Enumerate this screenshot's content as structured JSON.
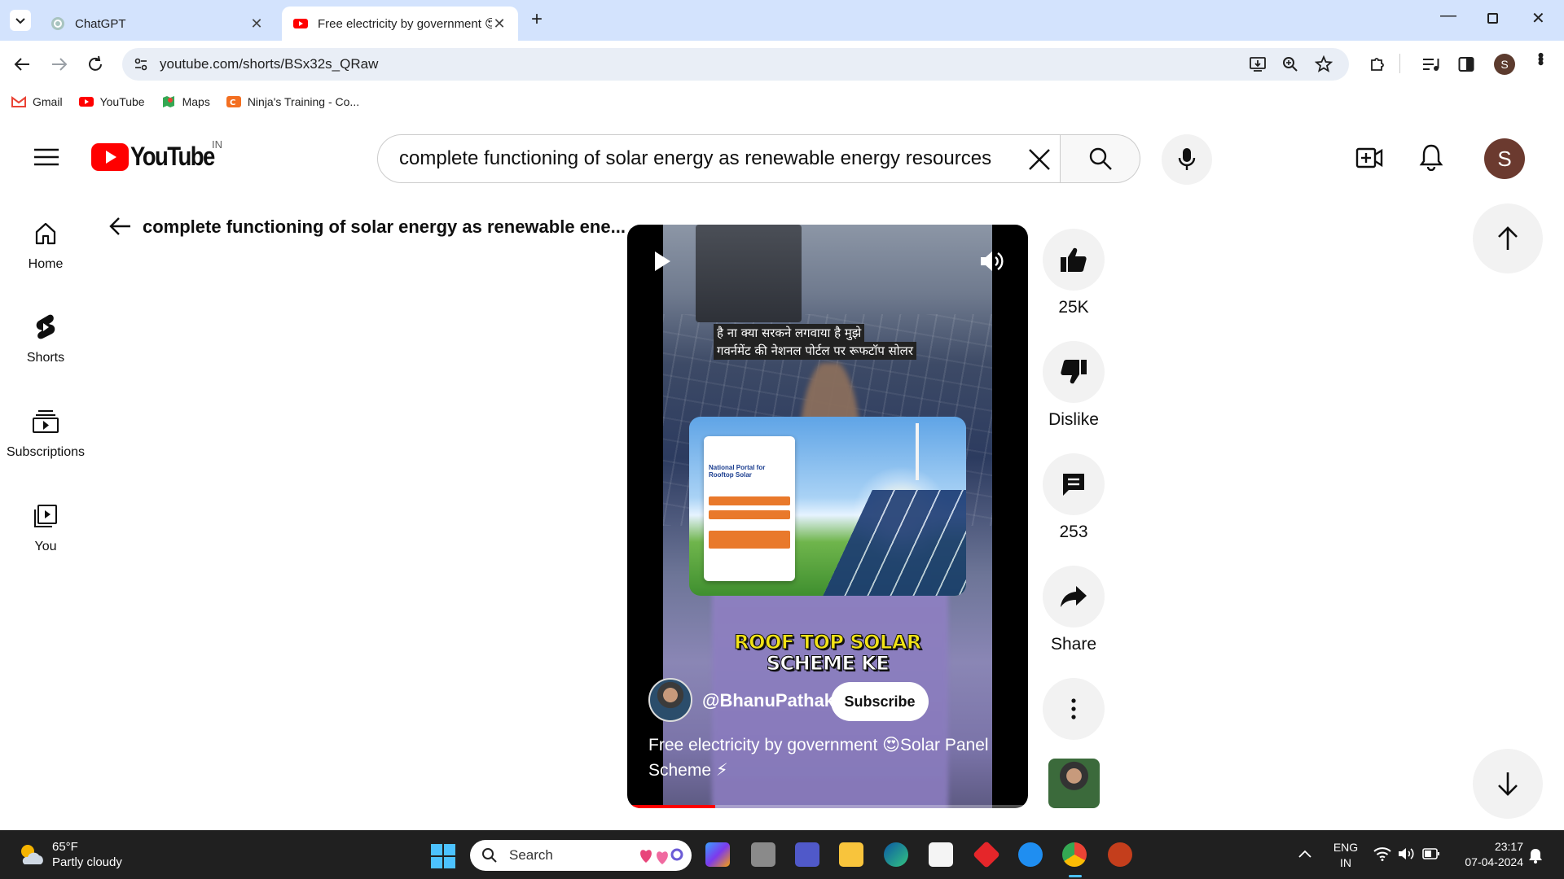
{
  "browser": {
    "tabs": [
      {
        "title": "ChatGPT",
        "active": false
      },
      {
        "title": "Free electricity by government 😍",
        "active": true
      }
    ],
    "url": "youtube.com/shorts/BSx32s_QRaw",
    "profile_initial": "S",
    "bookmarks": [
      "Gmail",
      "YouTube",
      "Maps",
      "Ninja's Training - Co..."
    ]
  },
  "youtube": {
    "logo_text": "YouTube",
    "region": "IN",
    "search_query": "complete functioning of solar energy as renewable energy resources",
    "avatar_initial": "S",
    "back_title": "complete functioning of solar energy as renewable ene...",
    "nav": [
      {
        "label": "Home",
        "icon": "home-icon"
      },
      {
        "label": "Shorts",
        "icon": "shorts-icon"
      },
      {
        "label": "Subscriptions",
        "icon": "subscriptions-icon"
      },
      {
        "label": "You",
        "icon": "you-icon"
      }
    ]
  },
  "video": {
    "caption_line1": "है ना क्या सरकने लगवाया है मुझे",
    "caption_line2": "गवर्नमेंट की नेशनल पोर्टल पर रूफटॉप सोलर",
    "overlay_line1": "ROOF TOP SOLAR",
    "overlay_line2": "SCHEME KE",
    "inset_portal_title": "National Portal for Rooftop Solar",
    "channel": "@BhanuPathak",
    "subscribe_label": "Subscribe",
    "title_line1": "Free electricity by government 😍Solar Panel",
    "title_line2": "Scheme ⚡",
    "progress_fraction": 0.22
  },
  "actions": {
    "likes": "25K",
    "dislike": "Dislike",
    "comments": "253",
    "share": "Share"
  },
  "taskbar": {
    "weather_temp": "65°F",
    "weather_desc": "Partly cloudy",
    "search_placeholder": "Search",
    "lang_line1": "ENG",
    "lang_line2": "IN",
    "time": "23:17",
    "date": "07-04-2024"
  },
  "colors": {
    "youtube_red": "#ff0000",
    "chrome_tab_bar": "#d3e3fd",
    "taskbar": "#202020",
    "overlay_yellow": "#f2e317"
  }
}
